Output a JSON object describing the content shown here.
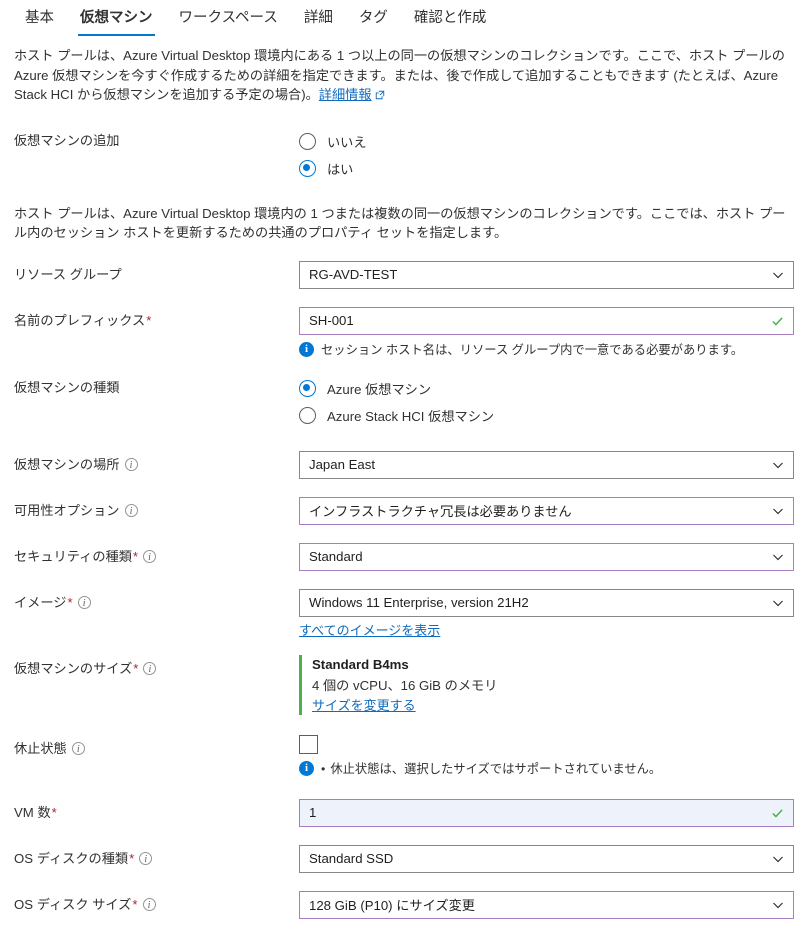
{
  "tabs": [
    {
      "label": "基本",
      "active": false
    },
    {
      "label": "仮想マシン",
      "active": true
    },
    {
      "label": "ワークスペース",
      "active": false
    },
    {
      "label": "詳細",
      "active": false
    },
    {
      "label": "タグ",
      "active": false
    },
    {
      "label": "確認と作成",
      "active": false
    }
  ],
  "intro": {
    "text": "ホスト プールは、Azure Virtual Desktop 環境内にある 1 つ以上の同一の仮想マシンのコレクションです。ここで、ホスト プールの Azure 仮想マシンを今すぐ作成するための詳細を指定できます。または、後で作成して追加することもできます (たとえば、Azure Stack HCI から仮想マシンを追加する予定の場合)。",
    "link": "詳細情報",
    "link_icon": "external-link-icon"
  },
  "add_vm": {
    "label": "仮想マシンの追加",
    "options": [
      {
        "label": "いいえ",
        "selected": false
      },
      {
        "label": "はい",
        "selected": true
      }
    ]
  },
  "description2": "ホスト プールは、Azure Virtual Desktop 環境内の 1 つまたは複数の同一の仮想マシンのコレクションです。ここでは、ホスト プール内のセッション ホストを更新するための共通のプロパティ セットを指定します。",
  "resource_group": {
    "label": "リソース グループ",
    "value": "RG-AVD-TEST",
    "icon": "chevron-down-icon"
  },
  "name_prefix": {
    "label": "名前のプレフィックス",
    "required": "*",
    "value": "SH-001",
    "valid_icon": "checkmark-icon",
    "info": "セッション ホスト名は、リソース グループ内で一意である必要があります。",
    "info_icon": "info-circle-icon"
  },
  "vm_type": {
    "label": "仮想マシンの種類",
    "options": [
      {
        "label": "Azure 仮想マシン",
        "selected": true
      },
      {
        "label": "Azure Stack HCI 仮想マシン",
        "selected": false
      }
    ]
  },
  "vm_location": {
    "label": "仮想マシンの場所",
    "info_icon": "info-outline-icon",
    "value": "Japan East",
    "icon": "chevron-down-icon"
  },
  "availability": {
    "label": "可用性オプション",
    "info_icon": "info-outline-icon",
    "value": "インフラストラクチャ冗長は必要ありません",
    "icon": "chevron-down-icon"
  },
  "security_type": {
    "label": "セキュリティの種類",
    "required": "*",
    "info_icon": "info-outline-icon",
    "value": "Standard",
    "icon": "chevron-down-icon"
  },
  "image": {
    "label": "イメージ",
    "required": "*",
    "info_icon": "info-outline-icon",
    "value": "Windows 11 Enterprise, version 21H2",
    "icon": "chevron-down-icon",
    "sublink": "すべてのイメージを表示"
  },
  "vm_size": {
    "label": "仮想マシンのサイズ",
    "required": "*",
    "info_icon": "info-outline-icon",
    "name": "Standard B4ms",
    "specs": "4 個の vCPU、16 GiB のメモリ",
    "change_link": "サイズを変更する",
    "accent_color": "#4cb04c"
  },
  "hibernate": {
    "label": "休止状態",
    "info_icon": "info-outline-icon",
    "checked": false,
    "message": "休止状態は、選択したサイズではサポートされていません。",
    "message_icon": "info-circle-icon",
    "bullet": "•"
  },
  "vm_count": {
    "label": "VM 数",
    "required": "*",
    "value": "1",
    "valid_icon": "checkmark-icon"
  },
  "os_disk_type": {
    "label": "OS ディスクの種類",
    "required": "*",
    "info_icon": "info-outline-icon",
    "value": "Standard SSD",
    "icon": "chevron-down-icon"
  },
  "os_disk_size": {
    "label": "OS ディスク サイズ",
    "required": "*",
    "info_icon": "info-outline-icon",
    "value": "128 GiB (P10) にサイズ変更",
    "icon": "chevron-down-icon"
  },
  "colors": {
    "accent_blue": "#0078d4",
    "link_blue": "#0f6cbd",
    "required_red": "#a4262c",
    "modified_purple": "#a97dc4",
    "valid_green": "#4cb04c",
    "field_filled": "#eef2fb"
  }
}
